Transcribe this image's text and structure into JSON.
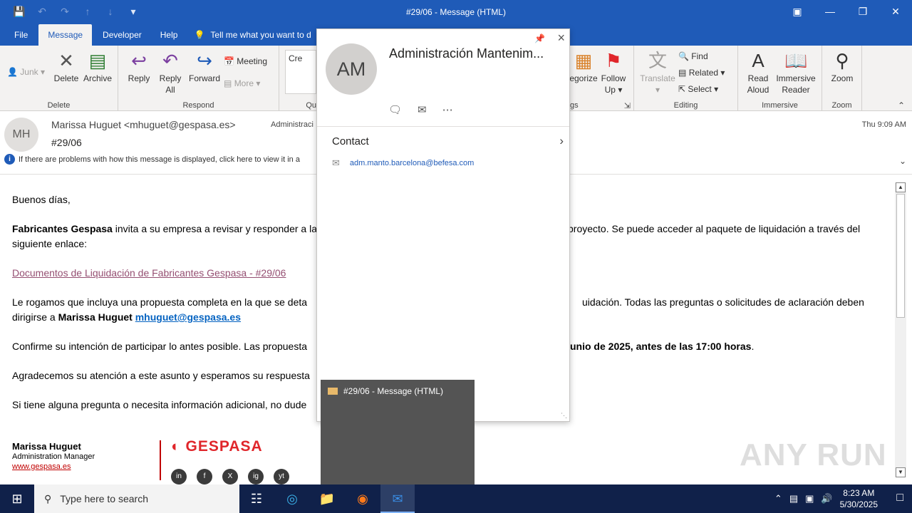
{
  "window": {
    "title": "#29/06  -  Message (HTML)",
    "qat": [
      "save-icon",
      "undo-icon",
      "redo-icon",
      "up-icon",
      "down-icon",
      "customize-icon"
    ]
  },
  "tabs": [
    "File",
    "Message",
    "Developer",
    "Help"
  ],
  "tell_me": "Tell me what you want to d",
  "ribbon": {
    "delete_group": {
      "label": "Delete",
      "junk": "Junk",
      "delete": "Delete",
      "archive": "Archive"
    },
    "respond_group": {
      "label": "Respond",
      "reply": "Reply",
      "reply_all_1": "Reply",
      "reply_all_2": "All",
      "forward": "Forward",
      "meeting": "Meeting",
      "more": "More"
    },
    "quick_group": {
      "label": "Qu",
      "create": "Cre"
    },
    "tags_group": {
      "label": "gs",
      "categorize": "egorize",
      "follow_1": "Follow",
      "follow_2": "Up"
    },
    "editing_group": {
      "label": "Editing",
      "translate": "Translate",
      "find": "Find",
      "related": "Related",
      "select": "Select"
    },
    "immersive_group": {
      "label": "Immersive",
      "read_1": "Read",
      "read_2": "Aloud",
      "reader_1": "Immersive",
      "reader_2": "Reader"
    },
    "zoom_group": {
      "label": "Zoom",
      "zoom": "Zoom"
    }
  },
  "message": {
    "avatar": "MH",
    "from": "Marissa Huguet <mhuguet@gespasa.es>",
    "to": "Administraci",
    "subject": "#29/06",
    "time": "Thu 9:09 AM",
    "info": "If there are problems with how this message is displayed, click here to view it in a"
  },
  "body": {
    "greeting": "Buenos días,",
    "p1_bold": "Fabricantes Gespasa",
    "p1_a": " invita a su empresa a revisar y responder a la",
    "p1_b": "proyecto. Se puede acceder al paquete de liquidación a través del",
    "p1_c": "siguiente enlace:",
    "link": "Documentos de Liquidación de Fabricantes Gespasa - #29/06",
    "p2_a": "Le rogamos que incluya una propuesta completa en la que se deta",
    "p2_b": "uidación. Todas las preguntas o solicitudes de aclaración deben",
    "p2_c": "dirigirse a ",
    "p2_name": "Marissa Huguet",
    "p2_mail": "mhuguet@gespasa.es",
    "p3_a": "Confirme su intención de participar lo antes posible. Las propuesta",
    "p3_b": "unio de 2025, antes de las 17:00 horas",
    "p3_end": ".",
    "p4": "Agradecemos su atención a este asunto y esperamos su respuesta",
    "p5": "Si tiene alguna pregunta o necesita información adicional, no dude",
    "sig_name": "Marissa Huguet",
    "sig_title": "Administration Manager",
    "sig_web": "www.gespasa.es",
    "logo": "GESPASA",
    "social": [
      "in",
      "f",
      "X",
      "ig",
      "yt"
    ]
  },
  "contact_card": {
    "initials": "AM",
    "name": "Administración Mantenim...",
    "section": "Contact",
    "email": "adm.manto.barcelona@befesa.com"
  },
  "taskbar_preview": {
    "title": "#29/06 - Message (HTML)"
  },
  "watermark": "ANY RUN",
  "taskbar": {
    "search_placeholder": "Type here to search",
    "time": "8:23 AM",
    "date": "5/30/2025"
  }
}
